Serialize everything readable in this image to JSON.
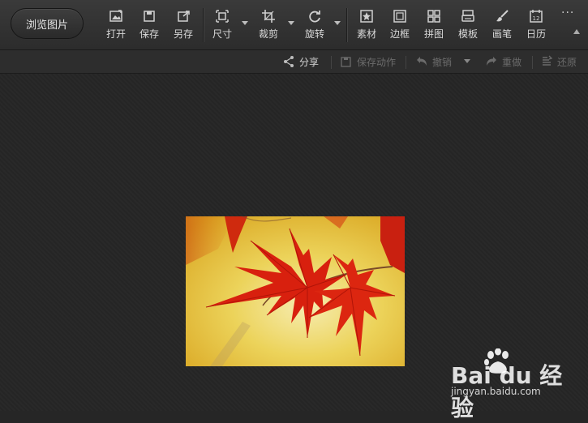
{
  "toolbar": {
    "browse_label": "浏览图片",
    "tools": [
      {
        "label": "打开",
        "icon": "open-image-icon"
      },
      {
        "label": "保存",
        "icon": "save-icon"
      },
      {
        "label": "另存",
        "icon": "save-as-icon"
      },
      {
        "label": "尺寸",
        "icon": "resize-icon"
      },
      {
        "label": "裁剪",
        "icon": "crop-icon"
      },
      {
        "label": "旋转",
        "icon": "rotate-icon"
      },
      {
        "label": "素材",
        "icon": "material-icon"
      },
      {
        "label": "边框",
        "icon": "border-icon"
      },
      {
        "label": "拼图",
        "icon": "collage-icon"
      },
      {
        "label": "模板",
        "icon": "template-icon"
      },
      {
        "label": "画笔",
        "icon": "brush-icon"
      },
      {
        "label": "日历",
        "icon": "calendar-icon",
        "day": "12"
      }
    ],
    "more": "···"
  },
  "subbar": {
    "share": "分享",
    "save_action": "保存动作",
    "undo": "撤销",
    "redo": "重做",
    "restore": "还原"
  },
  "watermark": {
    "logo_text": "Bai du 经验",
    "url": "jingyan.baidu.com"
  },
  "colors": {
    "toolbar_bg": "#333333",
    "canvas_bg": "#252525",
    "leaf_red": "#d8200e",
    "photo_bg": "#e9c93d"
  }
}
